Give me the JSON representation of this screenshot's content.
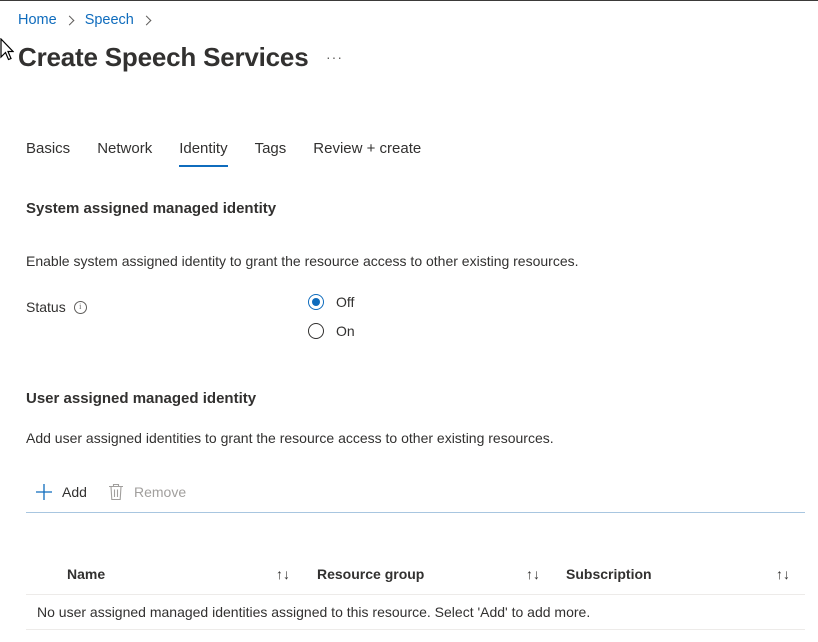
{
  "breadcrumb": [
    {
      "label": "Home"
    },
    {
      "label": "Speech"
    }
  ],
  "page": {
    "title": "Create Speech Services",
    "more_label": "···"
  },
  "tabs": [
    {
      "label": "Basics"
    },
    {
      "label": "Network"
    },
    {
      "label": "Identity",
      "active": true
    },
    {
      "label": "Tags"
    },
    {
      "label": "Review + create"
    }
  ],
  "system_identity": {
    "heading": "System assigned managed identity",
    "description": "Enable system assigned identity to grant the resource access to other existing resources.",
    "status_label": "Status",
    "options": [
      {
        "label": "Off",
        "selected": true
      },
      {
        "label": "On",
        "selected": false
      }
    ]
  },
  "user_identity": {
    "heading": "User assigned managed identity",
    "description": "Add user assigned identities to grant the resource access to other existing resources.",
    "add_label": "Add",
    "remove_label": "Remove",
    "columns": [
      {
        "label": "Name"
      },
      {
        "label": "Resource group"
      },
      {
        "label": "Subscription"
      }
    ],
    "empty_message": "No user assigned managed identities assigned to this resource. Select 'Add' to add more."
  },
  "colors": {
    "accent": "#0f6cbd",
    "text": "#323130",
    "disabled": "#a19f9d"
  }
}
